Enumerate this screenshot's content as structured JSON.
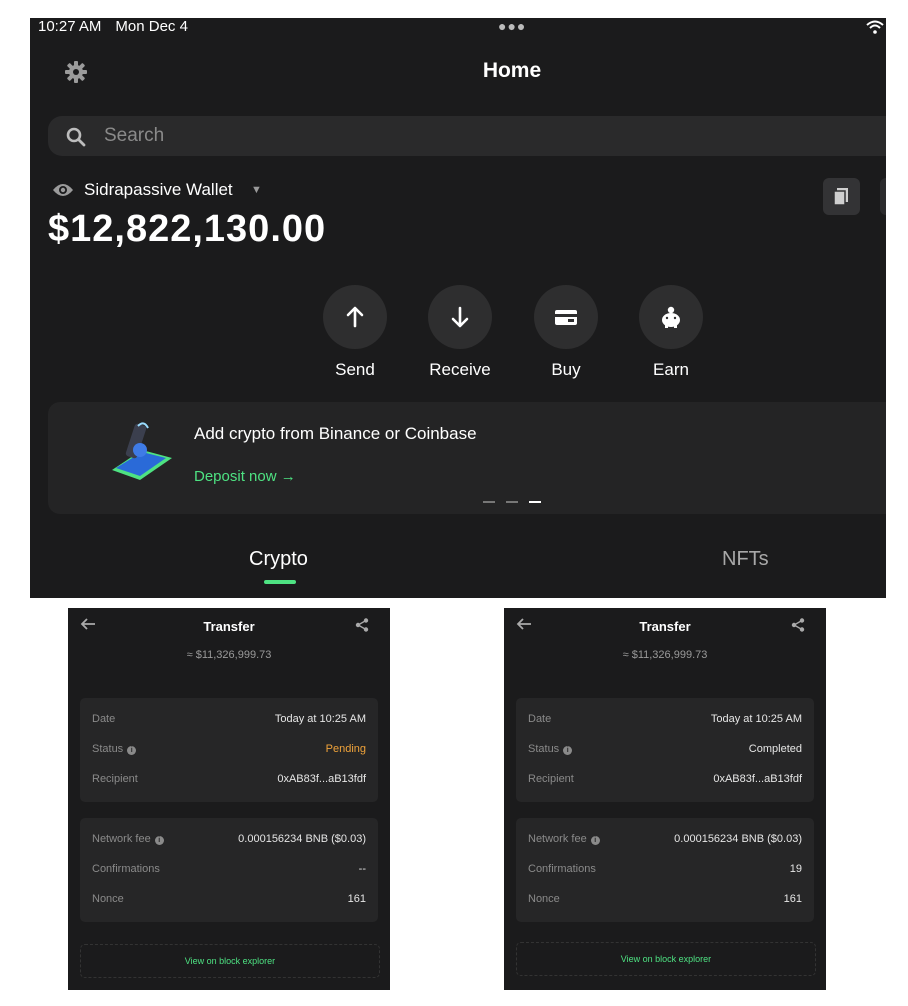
{
  "status_bar": {
    "time": "10:27 AM",
    "date": "Mon Dec 4"
  },
  "header": {
    "title": "Home"
  },
  "search": {
    "placeholder": "Search"
  },
  "wallet": {
    "name": "Sidrapassive Wallet",
    "balance": "$12,822,130.00"
  },
  "actions": [
    {
      "label": "Send",
      "icon": "arrow-up-icon"
    },
    {
      "label": "Receive",
      "icon": "arrow-down-icon"
    },
    {
      "label": "Buy",
      "icon": "card-icon"
    },
    {
      "label": "Earn",
      "icon": "piggy-bank-icon"
    }
  ],
  "banner": {
    "text": "Add crypto from Binance or Coinbase",
    "cta": "Deposit now →",
    "page_count": 3,
    "active_page": 3
  },
  "tabs": [
    {
      "label": "Crypto",
      "active": true
    },
    {
      "label": "NFTs",
      "active": false
    }
  ],
  "colors": {
    "accent": "#4ee282",
    "pending": "#f0a33a",
    "background": "#1b1b1c"
  },
  "transfers": [
    {
      "title": "Transfer",
      "amount": "≈ $11,326,999.73",
      "details": [
        {
          "key": "Date",
          "value": "Today at 10:25 AM"
        },
        {
          "key": "Status",
          "value": "Pending"
        },
        {
          "key": "Recipient",
          "value": "0xAB83f...aB13fdf"
        }
      ],
      "fees": [
        {
          "key": "Network fee",
          "value": "0.000156234 BNB ($0.03)"
        },
        {
          "key": "Confirmations",
          "value": "--"
        },
        {
          "key": "Nonce",
          "value": "161"
        }
      ],
      "explorer": "View on block explorer"
    },
    {
      "title": "Transfer",
      "amount": "≈ $11,326,999.73",
      "details": [
        {
          "key": "Date",
          "value": "Today at 10:25 AM"
        },
        {
          "key": "Status",
          "value": "Completed"
        },
        {
          "key": "Recipient",
          "value": "0xAB83f...aB13fdf"
        }
      ],
      "fees": [
        {
          "key": "Network fee",
          "value": "0.000156234 BNB ($0.03)"
        },
        {
          "key": "Confirmations",
          "value": "19"
        },
        {
          "key": "Nonce",
          "value": "161"
        }
      ],
      "explorer": "View on block explorer"
    }
  ]
}
